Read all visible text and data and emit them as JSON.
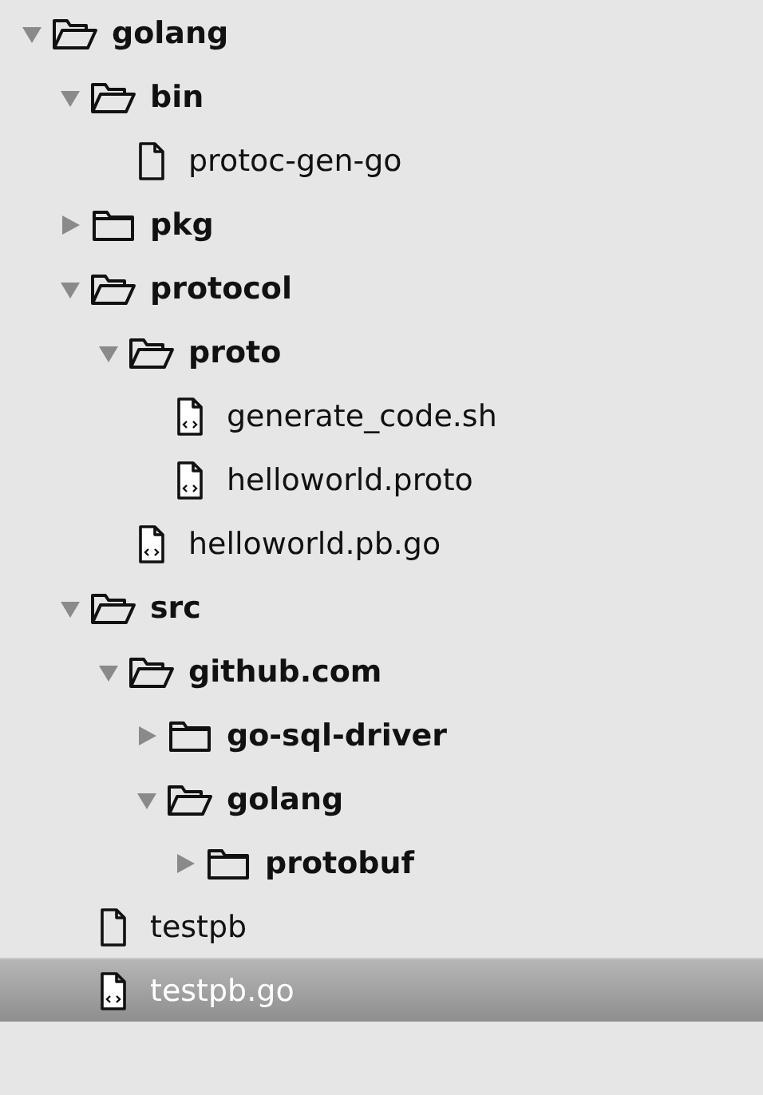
{
  "tree": [
    {
      "name": "golang",
      "kind": "folder",
      "expanded": true,
      "selected": false,
      "children": [
        {
          "name": "bin",
          "kind": "folder",
          "expanded": true,
          "selected": false,
          "children": [
            {
              "name": "protoc-gen-go",
              "kind": "file",
              "selected": false
            }
          ]
        },
        {
          "name": "pkg",
          "kind": "folder",
          "expanded": false,
          "selected": false
        },
        {
          "name": "protocol",
          "kind": "folder",
          "expanded": true,
          "selected": false,
          "children": [
            {
              "name": "proto",
              "kind": "folder",
              "expanded": true,
              "selected": false,
              "children": [
                {
                  "name": "generate_code.sh",
                  "kind": "code",
                  "selected": false
                },
                {
                  "name": "helloworld.proto",
                  "kind": "code",
                  "selected": false
                }
              ]
            },
            {
              "name": "helloworld.pb.go",
              "kind": "code",
              "selected": false
            }
          ]
        },
        {
          "name": "src",
          "kind": "folder",
          "expanded": true,
          "selected": false,
          "children": [
            {
              "name": "github.com",
              "kind": "folder",
              "expanded": true,
              "selected": false,
              "children": [
                {
                  "name": "go-sql-driver",
                  "kind": "folder",
                  "expanded": false,
                  "selected": false
                },
                {
                  "name": "golang",
                  "kind": "folder",
                  "expanded": true,
                  "selected": false,
                  "children": [
                    {
                      "name": "protobuf",
                      "kind": "folder",
                      "expanded": false,
                      "selected": false
                    }
                  ]
                }
              ]
            }
          ]
        },
        {
          "name": "testpb",
          "kind": "file",
          "selected": false
        },
        {
          "name": "testpb.go",
          "kind": "code",
          "selected": true
        }
      ]
    }
  ]
}
